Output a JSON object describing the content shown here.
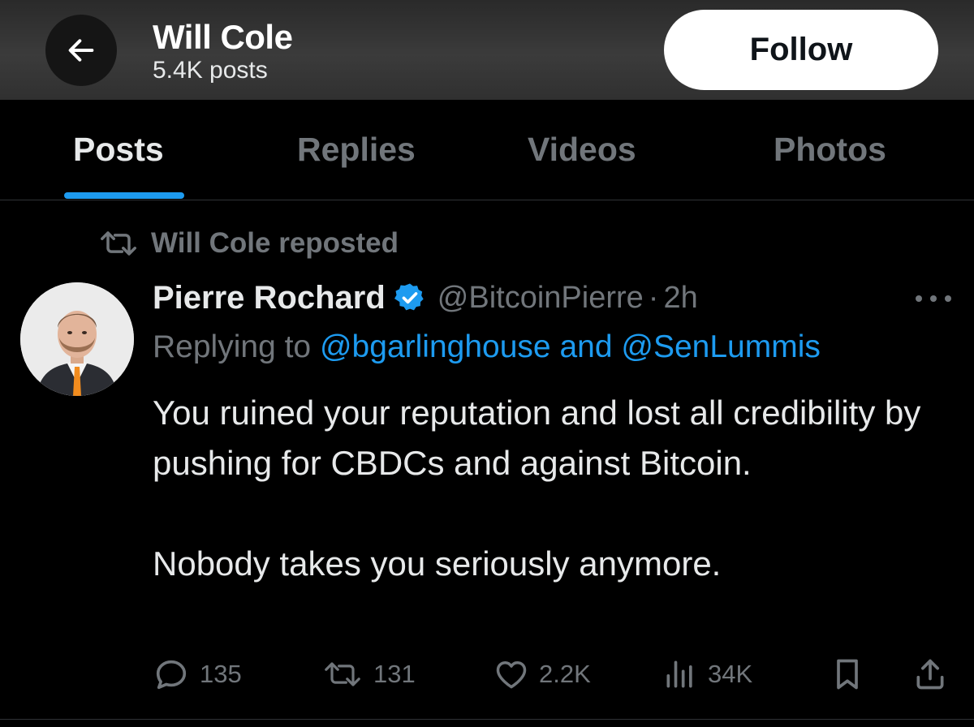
{
  "header": {
    "back_icon": "arrow-left-icon",
    "profile_name": "Will Cole",
    "post_count": "5.4K posts",
    "follow_label": "Follow"
  },
  "tabs": [
    {
      "label": "Posts",
      "active": true
    },
    {
      "label": "Replies",
      "active": false
    },
    {
      "label": "Videos",
      "active": false
    },
    {
      "label": "Photos",
      "active": false
    }
  ],
  "post": {
    "repost_icon": "repost-icon",
    "repost_text": "Will Cole reposted",
    "author_name": "Pierre Rochard",
    "verified_icon": "verified-badge-icon",
    "handle": "@BitcoinPierre",
    "separator": "·",
    "time": "2h",
    "more_icon": "more-horizontal-icon",
    "replying_prefix": "Replying to",
    "mention_1": "@bgarlinghouse",
    "mention_joiner": "and",
    "mention_2": "@SenLummis",
    "body_paragraph_1": "You ruined your reputation and lost all credibility by pushing for CBDCs and against Bitcoin.",
    "body_paragraph_2": "Nobody takes you seriously anymore.",
    "stats": {
      "replies": "135",
      "reposts": "131",
      "likes": "2.2K",
      "views": "34K"
    }
  },
  "colors": {
    "background": "#000000",
    "accent": "#1d9bf0",
    "muted": "#71767b",
    "text": "#e7e9ea"
  }
}
